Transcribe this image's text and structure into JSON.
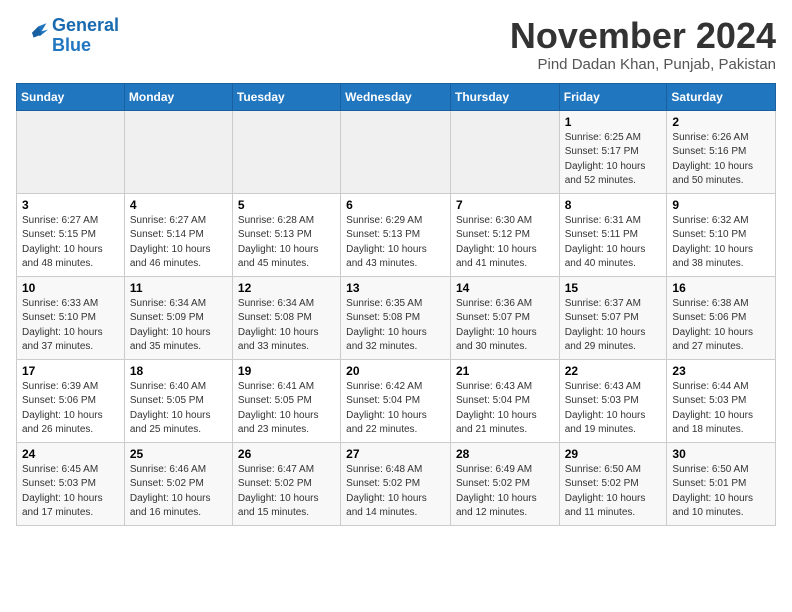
{
  "header": {
    "logo_line1": "General",
    "logo_line2": "Blue",
    "month": "November 2024",
    "location": "Pind Dadan Khan, Punjab, Pakistan"
  },
  "weekdays": [
    "Sunday",
    "Monday",
    "Tuesday",
    "Wednesday",
    "Thursday",
    "Friday",
    "Saturday"
  ],
  "weeks": [
    [
      {
        "day": "",
        "info": ""
      },
      {
        "day": "",
        "info": ""
      },
      {
        "day": "",
        "info": ""
      },
      {
        "day": "",
        "info": ""
      },
      {
        "day": "",
        "info": ""
      },
      {
        "day": "1",
        "info": "Sunrise: 6:25 AM\nSunset: 5:17 PM\nDaylight: 10 hours and 52 minutes."
      },
      {
        "day": "2",
        "info": "Sunrise: 6:26 AM\nSunset: 5:16 PM\nDaylight: 10 hours and 50 minutes."
      }
    ],
    [
      {
        "day": "3",
        "info": "Sunrise: 6:27 AM\nSunset: 5:15 PM\nDaylight: 10 hours and 48 minutes."
      },
      {
        "day": "4",
        "info": "Sunrise: 6:27 AM\nSunset: 5:14 PM\nDaylight: 10 hours and 46 minutes."
      },
      {
        "day": "5",
        "info": "Sunrise: 6:28 AM\nSunset: 5:13 PM\nDaylight: 10 hours and 45 minutes."
      },
      {
        "day": "6",
        "info": "Sunrise: 6:29 AM\nSunset: 5:13 PM\nDaylight: 10 hours and 43 minutes."
      },
      {
        "day": "7",
        "info": "Sunrise: 6:30 AM\nSunset: 5:12 PM\nDaylight: 10 hours and 41 minutes."
      },
      {
        "day": "8",
        "info": "Sunrise: 6:31 AM\nSunset: 5:11 PM\nDaylight: 10 hours and 40 minutes."
      },
      {
        "day": "9",
        "info": "Sunrise: 6:32 AM\nSunset: 5:10 PM\nDaylight: 10 hours and 38 minutes."
      }
    ],
    [
      {
        "day": "10",
        "info": "Sunrise: 6:33 AM\nSunset: 5:10 PM\nDaylight: 10 hours and 37 minutes."
      },
      {
        "day": "11",
        "info": "Sunrise: 6:34 AM\nSunset: 5:09 PM\nDaylight: 10 hours and 35 minutes."
      },
      {
        "day": "12",
        "info": "Sunrise: 6:34 AM\nSunset: 5:08 PM\nDaylight: 10 hours and 33 minutes."
      },
      {
        "day": "13",
        "info": "Sunrise: 6:35 AM\nSunset: 5:08 PM\nDaylight: 10 hours and 32 minutes."
      },
      {
        "day": "14",
        "info": "Sunrise: 6:36 AM\nSunset: 5:07 PM\nDaylight: 10 hours and 30 minutes."
      },
      {
        "day": "15",
        "info": "Sunrise: 6:37 AM\nSunset: 5:07 PM\nDaylight: 10 hours and 29 minutes."
      },
      {
        "day": "16",
        "info": "Sunrise: 6:38 AM\nSunset: 5:06 PM\nDaylight: 10 hours and 27 minutes."
      }
    ],
    [
      {
        "day": "17",
        "info": "Sunrise: 6:39 AM\nSunset: 5:06 PM\nDaylight: 10 hours and 26 minutes."
      },
      {
        "day": "18",
        "info": "Sunrise: 6:40 AM\nSunset: 5:05 PM\nDaylight: 10 hours and 25 minutes."
      },
      {
        "day": "19",
        "info": "Sunrise: 6:41 AM\nSunset: 5:05 PM\nDaylight: 10 hours and 23 minutes."
      },
      {
        "day": "20",
        "info": "Sunrise: 6:42 AM\nSunset: 5:04 PM\nDaylight: 10 hours and 22 minutes."
      },
      {
        "day": "21",
        "info": "Sunrise: 6:43 AM\nSunset: 5:04 PM\nDaylight: 10 hours and 21 minutes."
      },
      {
        "day": "22",
        "info": "Sunrise: 6:43 AM\nSunset: 5:03 PM\nDaylight: 10 hours and 19 minutes."
      },
      {
        "day": "23",
        "info": "Sunrise: 6:44 AM\nSunset: 5:03 PM\nDaylight: 10 hours and 18 minutes."
      }
    ],
    [
      {
        "day": "24",
        "info": "Sunrise: 6:45 AM\nSunset: 5:03 PM\nDaylight: 10 hours and 17 minutes."
      },
      {
        "day": "25",
        "info": "Sunrise: 6:46 AM\nSunset: 5:02 PM\nDaylight: 10 hours and 16 minutes."
      },
      {
        "day": "26",
        "info": "Sunrise: 6:47 AM\nSunset: 5:02 PM\nDaylight: 10 hours and 15 minutes."
      },
      {
        "day": "27",
        "info": "Sunrise: 6:48 AM\nSunset: 5:02 PM\nDaylight: 10 hours and 14 minutes."
      },
      {
        "day": "28",
        "info": "Sunrise: 6:49 AM\nSunset: 5:02 PM\nDaylight: 10 hours and 12 minutes."
      },
      {
        "day": "29",
        "info": "Sunrise: 6:50 AM\nSunset: 5:02 PM\nDaylight: 10 hours and 11 minutes."
      },
      {
        "day": "30",
        "info": "Sunrise: 6:50 AM\nSunset: 5:01 PM\nDaylight: 10 hours and 10 minutes."
      }
    ]
  ]
}
